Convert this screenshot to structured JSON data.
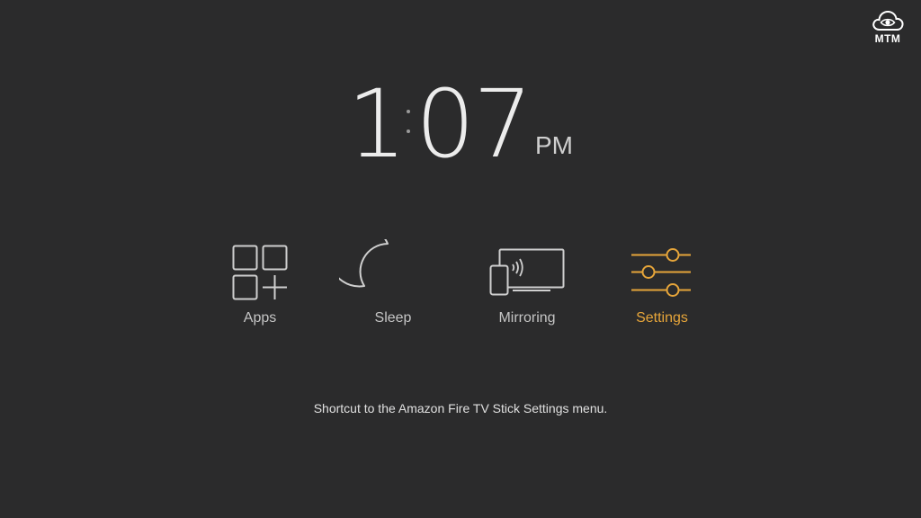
{
  "brand": {
    "logo_text": "MTM",
    "logo_icon": "cloud-eye-icon"
  },
  "clock": {
    "hour": "1",
    "minutes": "07",
    "ampm": "PM"
  },
  "menu": {
    "items": [
      {
        "label": "Apps",
        "icon": "apps-grid-plus-icon"
      },
      {
        "label": "Sleep",
        "icon": "moon-icon"
      },
      {
        "label": "Mirroring",
        "icon": "mirroring-icon"
      },
      {
        "label": "Settings",
        "icon": "sliders-icon"
      }
    ],
    "selected": "Settings"
  },
  "description": "Shortcut to the Amazon Fire TV Stick Settings menu.",
  "colors": {
    "background": "#2b2b2c",
    "accent": "#e6a53a",
    "text": "#c4c4c4"
  }
}
